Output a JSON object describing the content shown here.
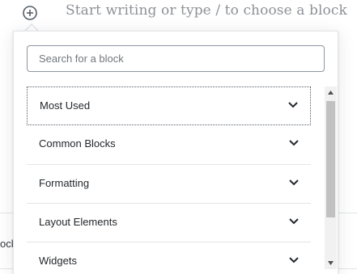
{
  "editor": {
    "placeholder": "Start writing or type / to choose a block",
    "cutoff_text": "ocks"
  },
  "inserter": {
    "search": {
      "placeholder": "Search for a block",
      "value": ""
    },
    "panels": [
      {
        "label": "Most Used",
        "icon": "chevron-down-icon"
      },
      {
        "label": "Common Blocks",
        "icon": "chevron-down-icon"
      },
      {
        "label": "Formatting",
        "icon": "chevron-down-icon"
      },
      {
        "label": "Layout Elements",
        "icon": "chevron-down-icon"
      },
      {
        "label": "Widgets",
        "icon": "chevron-down-icon"
      }
    ]
  },
  "colors": {
    "text": "#23282d",
    "border": "#e2e4e7",
    "placeholder": "#8d9196",
    "scroll_thumb": "#c1c1c1"
  }
}
